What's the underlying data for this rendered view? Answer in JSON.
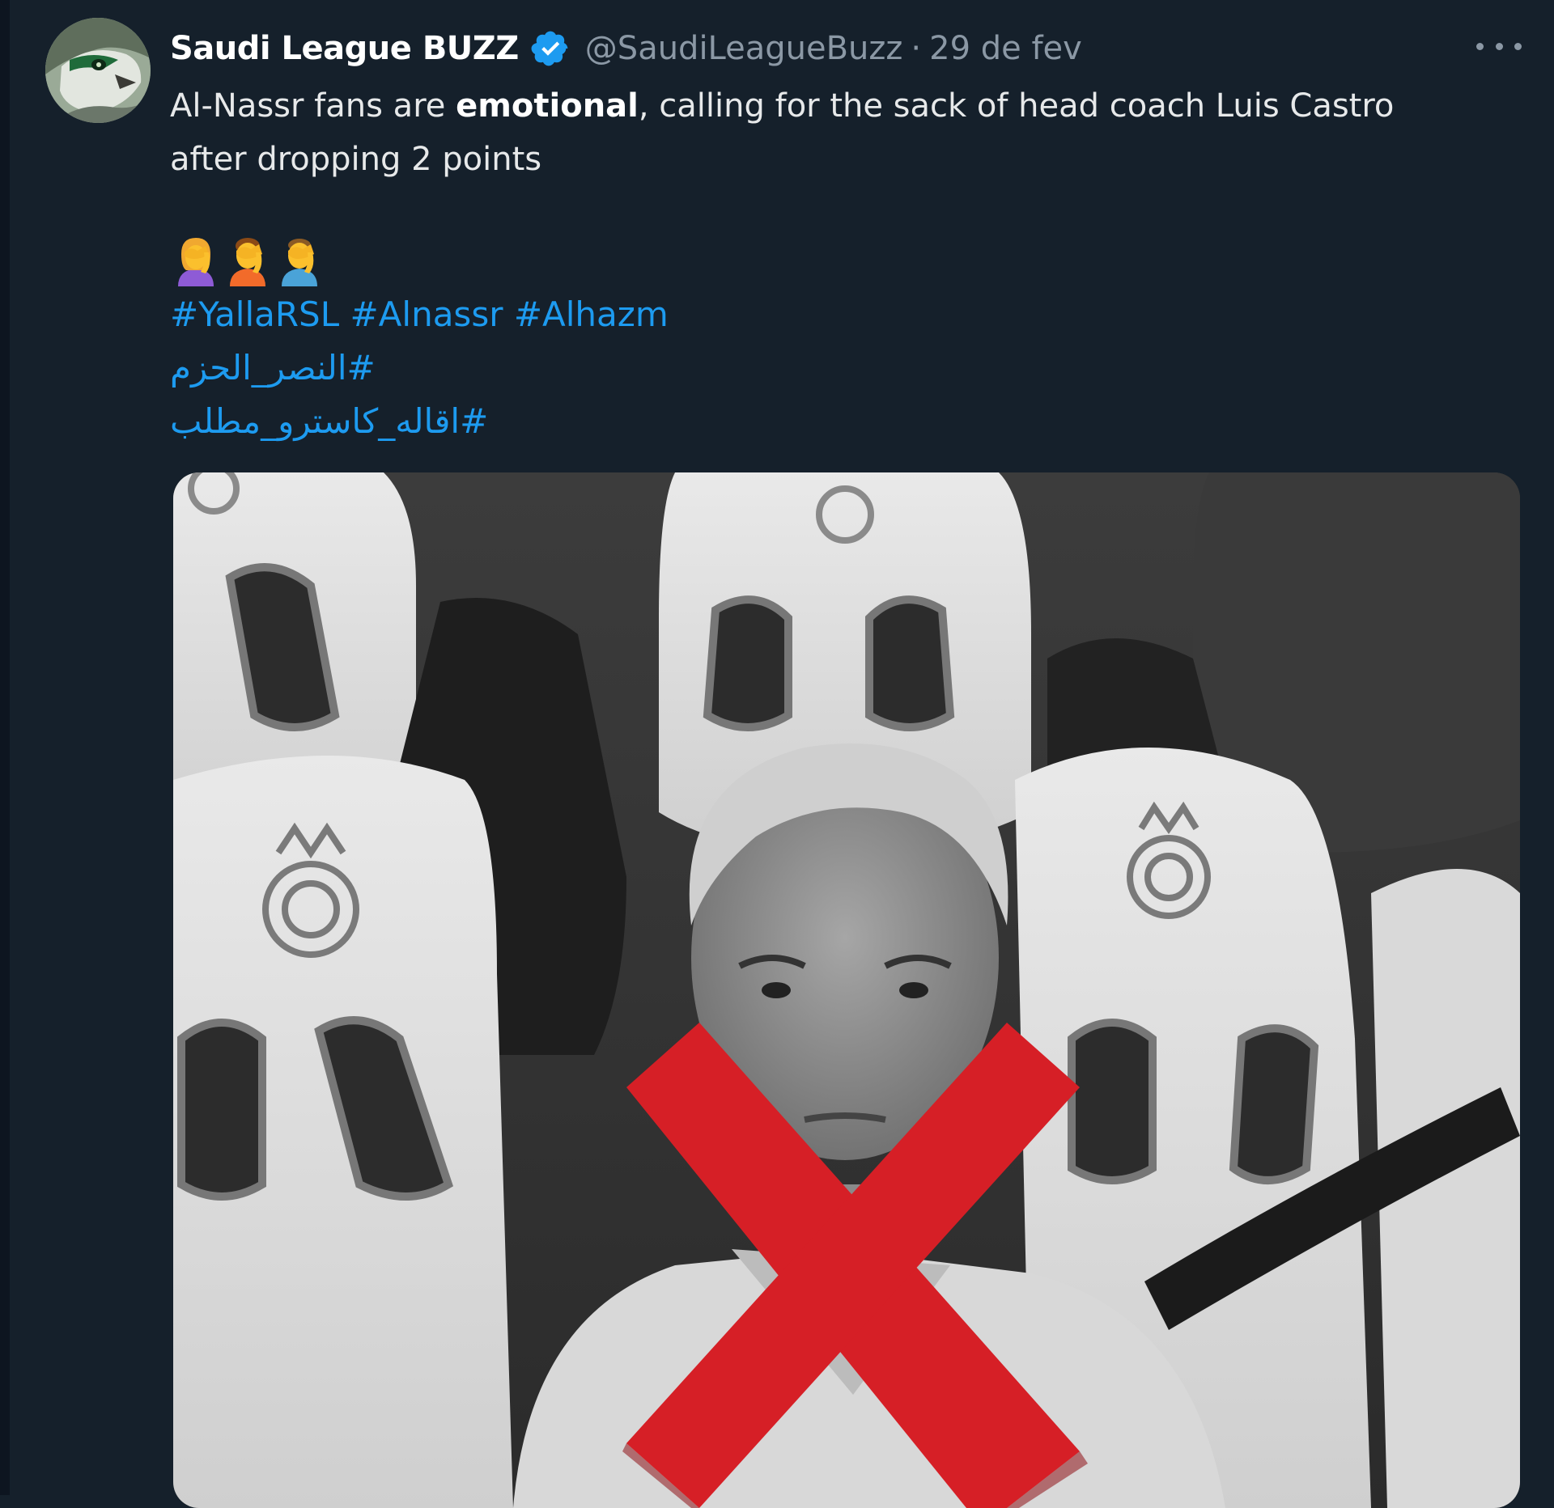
{
  "tweet": {
    "display_name": "Saudi League BUZZ",
    "handle": "@SaudiLeagueBuzz",
    "separator": "·",
    "date": "29 de fev",
    "text_line1_before": "Al-Nassr fans are ",
    "text_line1_bold": "emotional",
    "text_line1_after": ", calling for the sack of head coach Luis Castro",
    "text_line2": "after dropping 2 points",
    "emojis": [
      "woman-facepalming-icon",
      "person-facepalming-icon",
      "man-facepalming-icon"
    ],
    "hashtags_line1": [
      "#YallaRSL",
      "#Alnassr",
      "#Alhazm"
    ],
    "hashtag_arabic_1": "#النصر_الحزم",
    "hashtag_arabic_2": "#اقاله_كاسترو_مطلب"
  },
  "colors": {
    "background": "#15202b",
    "link": "#1d9bf0",
    "verified": "#1d9bf0",
    "muted": "#8b98a5",
    "cross": "#d61f26"
  },
  "icons": {
    "verified": "verified-badge-icon",
    "more": "more-options-icon"
  }
}
